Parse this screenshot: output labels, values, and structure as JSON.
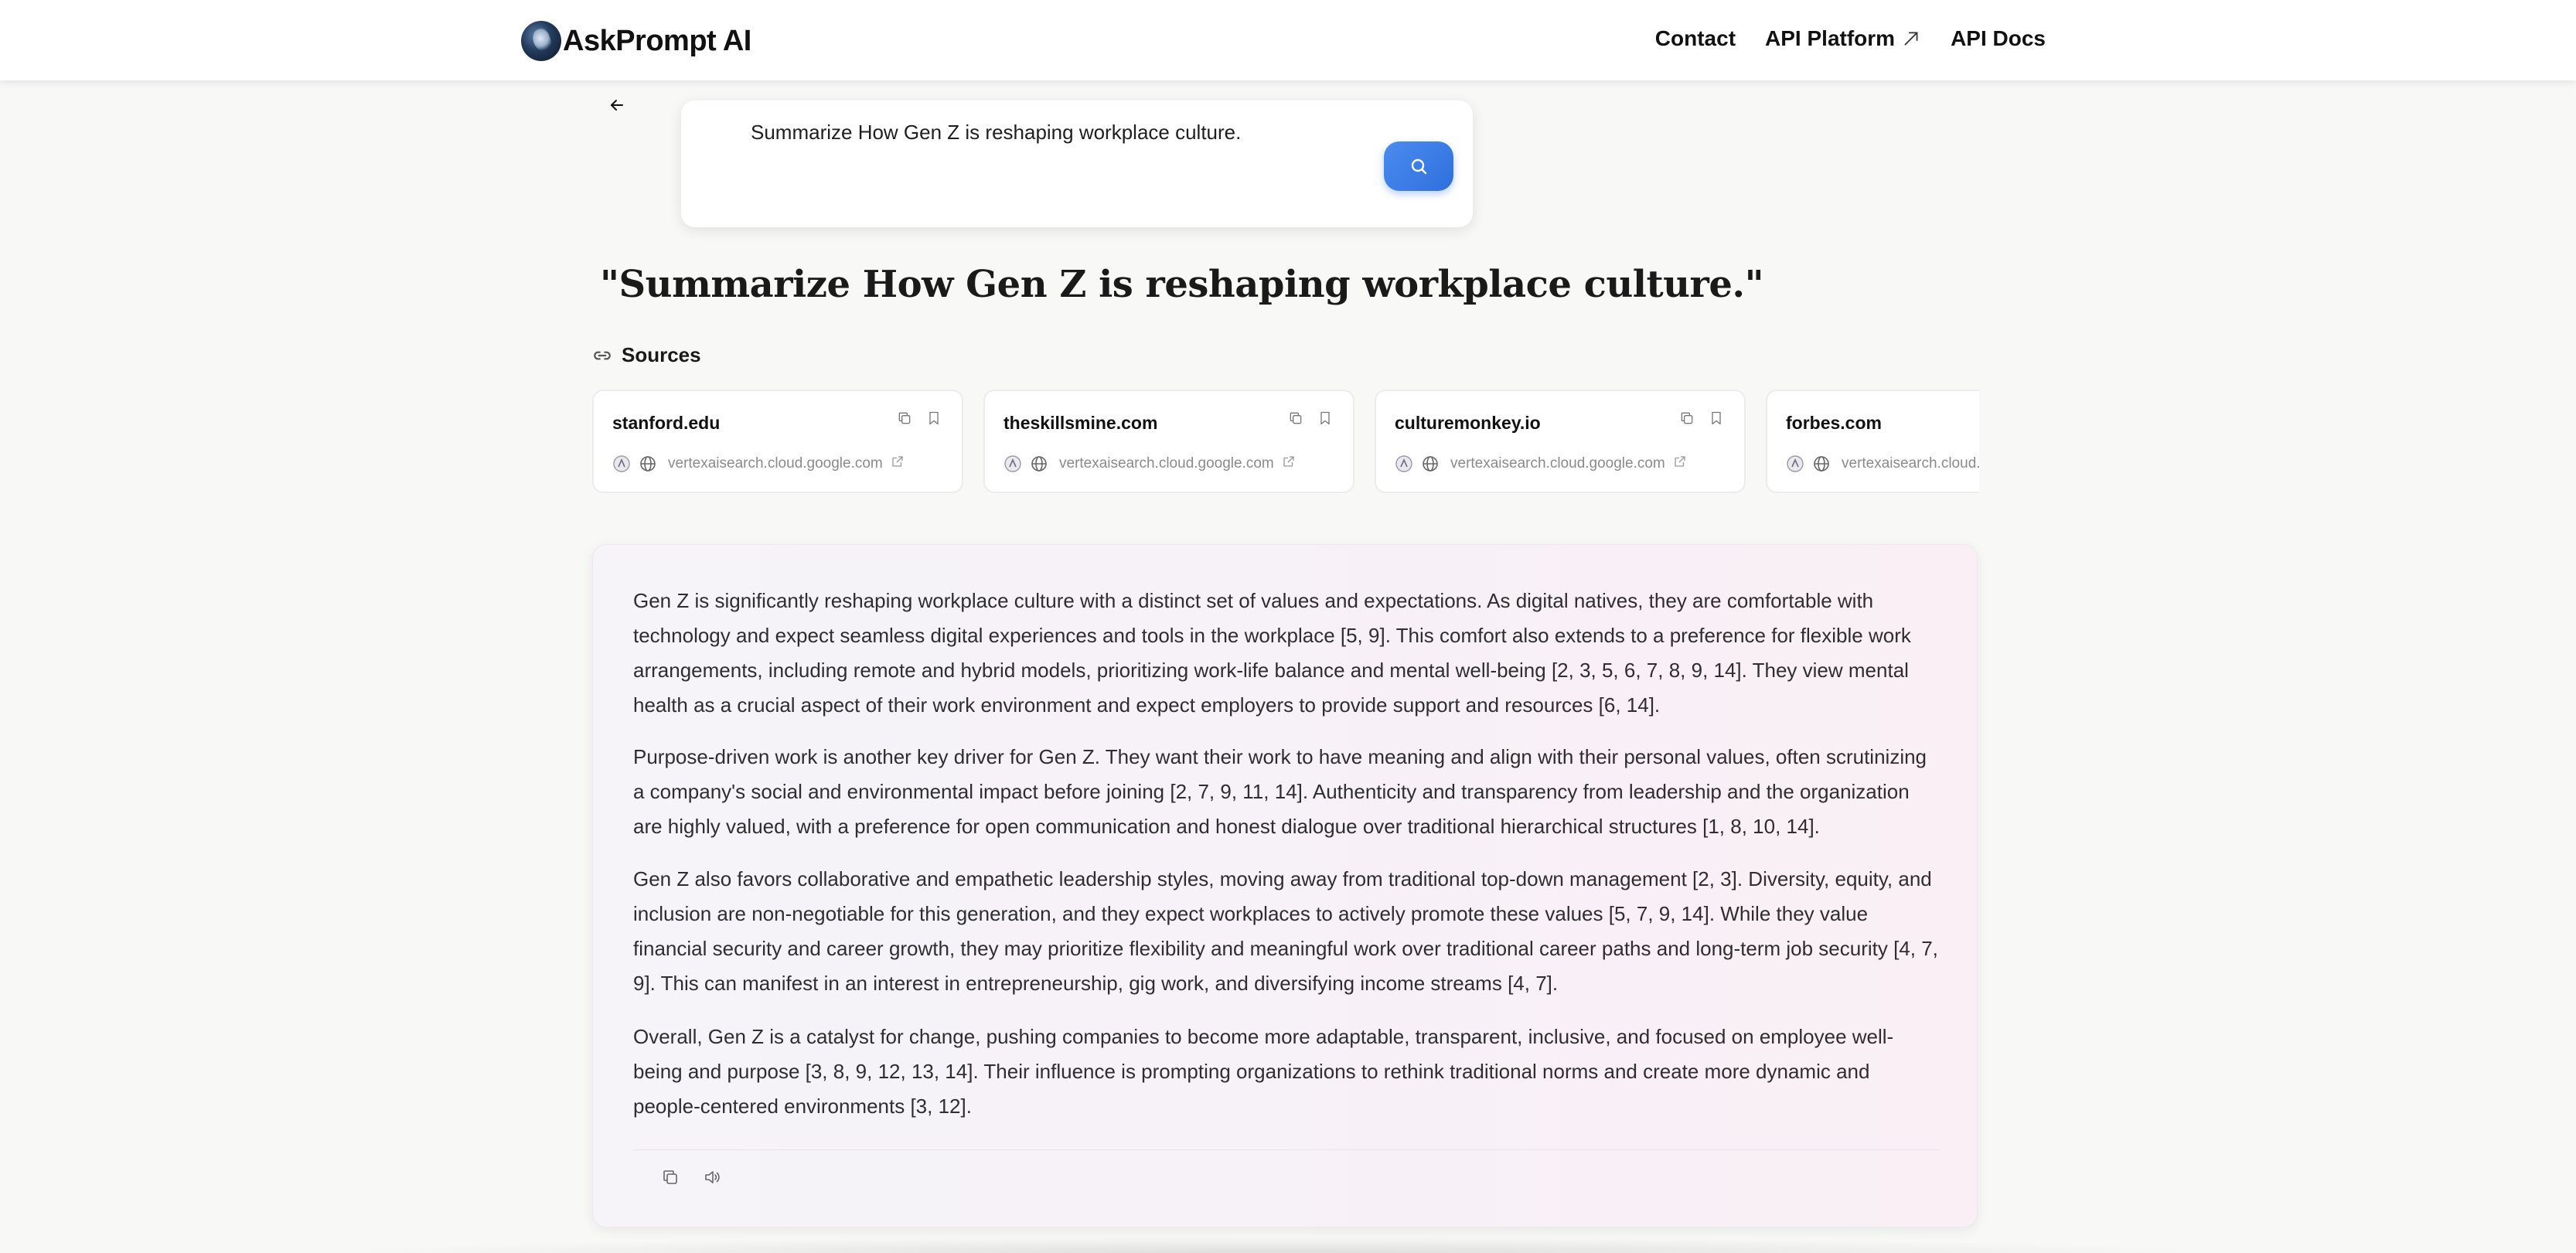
{
  "header": {
    "brand": "AskPrompt AI",
    "nav": [
      {
        "label": "Contact"
      },
      {
        "label": "API Platform",
        "icon": "external-arrow-icon"
      },
      {
        "label": "API Docs"
      }
    ]
  },
  "search": {
    "value": "Summarize How Gen Z is reshaping workplace culture.",
    "button_icon": "search-icon"
  },
  "query_title": "\"Summarize How Gen Z is reshaping workplace culture.\"",
  "sources": {
    "label": "Sources",
    "items": [
      {
        "title": "stanford.edu",
        "url": "vertexaisearch.cloud.google.com"
      },
      {
        "title": "theskillsmine.com",
        "url": "vertexaisearch.cloud.google.com"
      },
      {
        "title": "culturemonkey.io",
        "url": "vertexaisearch.cloud.google.com"
      },
      {
        "title": "forbes.com",
        "url": "vertexaisearch.cloud.google.com"
      }
    ]
  },
  "answer": {
    "paragraphs": [
      "Gen Z is significantly reshaping workplace culture with a distinct set of values and expectations. As digital natives, they are comfortable with technology and expect seamless digital experiences and tools in the workplace [5, 9]. This comfort also extends to a preference for flexible work arrangements, including remote and hybrid models, prioritizing work-life balance and mental well-being [2, 3, 5, 6, 7, 8, 9, 14]. They view mental health as a crucial aspect of their work environment and expect employers to provide support and resources [6, 14].",
      "Purpose-driven work is another key driver for Gen Z. They want their work to have meaning and align with their personal values, often scrutinizing a company's social and environmental impact before joining [2, 7, 9, 11, 14]. Authenticity and transparency from leadership and the organization are highly valued, with a preference for open communication and honest dialogue over traditional hierarchical structures [1, 8, 10, 14].",
      "Gen Z also favors collaborative and empathetic leadership styles, moving away from traditional top-down management [2, 3]. Diversity, equity, and inclusion are non-negotiable for this generation, and they expect workplaces to actively promote these values [5, 7, 9, 14]. While they value financial security and career growth, they may prioritize flexibility and meaningful work over traditional career paths and long-term job security [4, 7, 9]. This can manifest in an interest in entrepreneurship, gig work, and diversifying income streams [4, 7].",
      "Overall, Gen Z is a catalyst for change, pushing companies to become more adaptable, transparent, inclusive, and focused on employee well-being and purpose [3, 8, 9, 12, 13, 14]. Their influence is prompting organizations to rethink traditional norms and create more dynamic and people-centered environments [3, 12]."
    ],
    "tool_icons": [
      "copy-icon",
      "speaker-icon"
    ]
  },
  "colors": {
    "accent": "#2f6fdc",
    "page_bg": "#f8f8f7",
    "muted_text": "#8a8a8a"
  }
}
